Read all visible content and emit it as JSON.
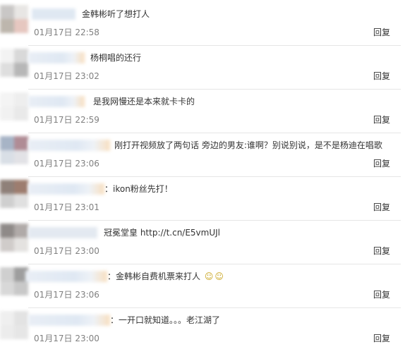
{
  "reply_label": "回复",
  "comments": [
    {
      "text": "金韩彬听了想打人",
      "time": "01月17日 22:58"
    },
    {
      "text": "杨桐唱的还行",
      "time": "01月17日 23:02"
    },
    {
      "text": "是我网慢还是本来就卡卡的",
      "time": "01月17日 22:59"
    },
    {
      "text": "刚打开视频放了两句话 旁边的男友:谁啊？别说别说，是不是杨迪在唱歌",
      "time": "01月17日 23:06"
    },
    {
      "text": "：ikon粉丝先打！",
      "time": "01月17日 23:01"
    },
    {
      "text": "冠冕堂皇 http://t.cn/E5vmUJl",
      "time": "01月17日 23:00"
    },
    {
      "text": "：金韩彬自费机票来打人",
      "time": "01月17日 23:06"
    },
    {
      "text": "：一开口就知道。。。老江湖了",
      "time": "01月17日 23:00"
    }
  ],
  "colors": {
    "text": "#333333",
    "time": "#808080",
    "divider": "#e6e6e6"
  }
}
